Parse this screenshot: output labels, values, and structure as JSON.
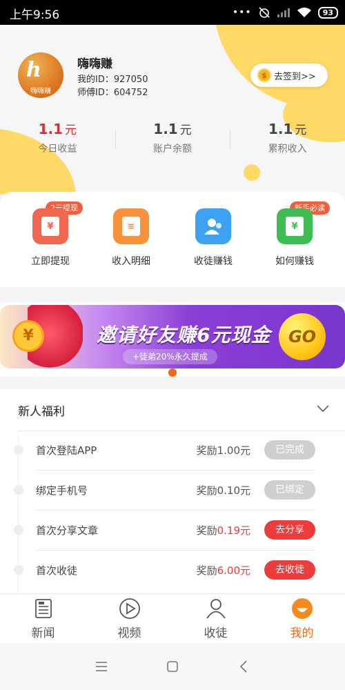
{
  "status_bar": {
    "time": "上午9:56",
    "dots": "•••",
    "battery": "93"
  },
  "profile": {
    "avatar_text": "嗨嗨赚",
    "nickname": "嗨嗨赚",
    "user_id": "我的ID：927050",
    "master_id": "师傅ID：604752",
    "signin_label": "去签到>>",
    "coin_glyph": "$"
  },
  "stats": [
    {
      "amount": "1.1",
      "unit": "元",
      "label": "今日收益",
      "highlight": true
    },
    {
      "amount": "1.1",
      "unit": "元",
      "label": "账户余额",
      "highlight": false
    },
    {
      "amount": "1.1",
      "unit": "元",
      "label": "累积收入",
      "highlight": false
    }
  ],
  "quick_entries": [
    {
      "label": "立即提现",
      "badge": "2元提现",
      "color": "#f0664f",
      "glyph": "¥",
      "icon": "wallet-icon"
    },
    {
      "label": "收入明细",
      "badge": "",
      "color": "#f7913a",
      "glyph": "≡",
      "icon": "document-icon"
    },
    {
      "label": "收徒赚钱",
      "badge": "",
      "color": "#3ea2f2",
      "glyph": "",
      "icon": "users-icon"
    },
    {
      "label": "如何赚钱",
      "badge": "新手必读",
      "color": "#3dbd52",
      "glyph": "¥",
      "icon": "money-bag-icon"
    }
  ],
  "banner": {
    "coin_glyph": "¥",
    "title": "邀请好友赚6元现金",
    "subtitle": "+徒弟20%永久提成",
    "go_label": "GO"
  },
  "newcomer": {
    "title": "新人福利",
    "tasks": [
      {
        "name": "首次登陆APP",
        "reward_prefix": "奖励",
        "reward_value": "1.00元",
        "highlight": false,
        "button": "已完成",
        "state": "done"
      },
      {
        "name": "绑定手机号",
        "reward_prefix": "奖励",
        "reward_value": "0.10元",
        "highlight": false,
        "button": "已绑定",
        "state": "done"
      },
      {
        "name": "首次分享文章",
        "reward_prefix": "奖励",
        "reward_value": "0.19元",
        "highlight": true,
        "button": "去分享",
        "state": "go"
      },
      {
        "name": "首次收徒",
        "reward_prefix": "奖励",
        "reward_value": "6.00元",
        "highlight": true,
        "button": "去收徒",
        "state": "go"
      }
    ]
  },
  "tabbar": {
    "tabs": [
      {
        "label": "新闻",
        "icon": "news-icon",
        "active": false
      },
      {
        "label": "视频",
        "icon": "play-icon",
        "active": false
      },
      {
        "label": "收徒",
        "icon": "user-icon",
        "active": false
      },
      {
        "label": "我的",
        "icon": "smile-icon",
        "active": true
      }
    ]
  },
  "colors": {
    "accent_orange": "#f06a12",
    "highlight_red": "#e6282a",
    "deco_yellow": "#ffd965"
  }
}
